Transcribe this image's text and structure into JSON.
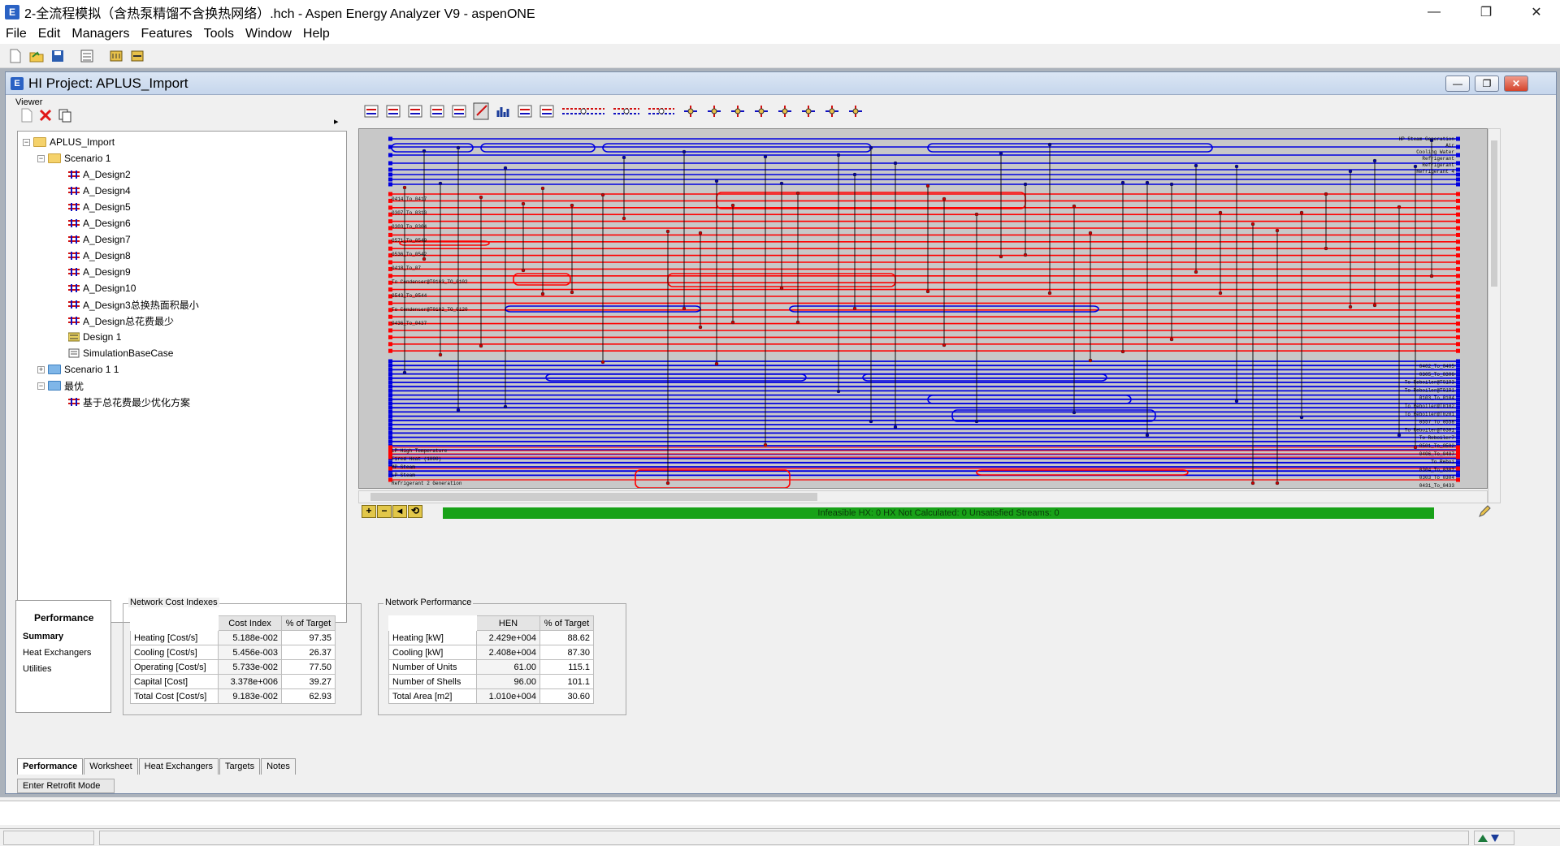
{
  "window": {
    "title": "2-全流程模拟（含热泵精馏不含换热网络）.hch - Aspen Energy Analyzer V9 - aspenONE",
    "app_icon_letter": "E",
    "minimize": "—",
    "maximize": "❐",
    "close": "✕"
  },
  "menu": {
    "items": [
      "File",
      "Edit",
      "Managers",
      "Features",
      "Tools",
      "Window",
      "Help"
    ]
  },
  "child": {
    "title": "HI Project:  APLUS_Import",
    "icon_letter": "E"
  },
  "viewer": {
    "label": "Viewer",
    "arrow": "▸"
  },
  "tree": {
    "root": "APLUS_Import",
    "scenario1": "Scenario 1",
    "designs": [
      "A_Design2",
      "A_Design4",
      "A_Design5",
      "A_Design6",
      "A_Design7",
      "A_Design8",
      "A_Design9",
      "A_Design10",
      "A_Design3总换热面积最小",
      "A_Design总花费最少"
    ],
    "design1": "Design 1",
    "simbase": "SimulationBaseCase",
    "scenario11": "Scenario 1 1",
    "best": "最优",
    "best_child": "基于总花费最少优化方案"
  },
  "grid": {
    "left_labels": [
      "0414_To_0417",
      "0307_To_0310",
      "0303_To_0304",
      "0571_To_0549",
      "0536_To_0542",
      "0418_To_07",
      "To Condenser@T0103_TO_0102",
      "0543_To_0544",
      "To Condenser@T0102_TO_0120",
      "0436_To_0437"
    ],
    "bottom_labels": [
      "LP High Temperature",
      "Fired Heat (1000)",
      "MP Steam",
      "LP Steam",
      "Refrigerant 2 Generation"
    ],
    "right_top_labels": [
      "HP Steam Generation",
      "Air",
      "Cooling Water",
      "Refrigerant",
      "Refrigerant",
      "Refrigerant 4"
    ],
    "right_labels": [
      "0402_To_0405",
      "0305_To_0306",
      "To Reboiler@T0103",
      "To Reboiler@T0101",
      "0103_To_0104",
      "To Reboiler@T0102",
      "To Reboiler@T0201",
      "0557_To_0558",
      "To Reboiler@T0301",
      "To Reboiler7",
      "0501_To_0502",
      "0406_To_0407",
      "To Reboi",
      "0304_To_0307",
      "0303_To_0304",
      "0431_To_0433"
    ],
    "status": "Infeasible HX: 0   HX Not Calculated: 0     Unsatisfied Streams: 0",
    "zoom": [
      "+",
      "−",
      "◂",
      "⟲"
    ]
  },
  "perf": {
    "nav_header": "Performance",
    "nav_items": [
      "Summary",
      "Heat Exchangers",
      "Utilities"
    ],
    "cost_title": "Network Cost Indexes",
    "cost_cols": [
      "",
      "Cost Index",
      "% of Target"
    ],
    "cost_rows": [
      [
        "Heating [Cost/s]",
        "5.188e-002",
        "97.35"
      ],
      [
        "Cooling [Cost/s]",
        "5.456e-003",
        "26.37"
      ],
      [
        "Operating [Cost/s]",
        "5.733e-002",
        "77.50"
      ],
      [
        "Capital [Cost]",
        "3.378e+006",
        "39.27"
      ],
      [
        "Total Cost [Cost/s]",
        "9.183e-002",
        "62.93"
      ]
    ],
    "net_title": "Network Performance",
    "net_cols": [
      "",
      "HEN",
      "% of Target"
    ],
    "net_rows": [
      [
        "Heating [kW]",
        "2.429e+004",
        "88.62"
      ],
      [
        "Cooling [kW]",
        "2.408e+004",
        "87.30"
      ],
      [
        "Number of Units",
        "61.00",
        "115.1"
      ],
      [
        "Number of Shells",
        "96.00",
        "101.1"
      ],
      [
        "Total Area [m2]",
        "1.010e+004",
        "30.60"
      ]
    ]
  },
  "tabs": [
    "Performance",
    "Worksheet",
    "Heat Exchangers",
    "Targets",
    "Notes"
  ],
  "retrofit": "Enter Retrofit Mode",
  "colors": {
    "hot": "#ff0000",
    "cold": "#0000e0",
    "grid_bg": "#c8c8c8",
    "status_green": "#18a218"
  }
}
